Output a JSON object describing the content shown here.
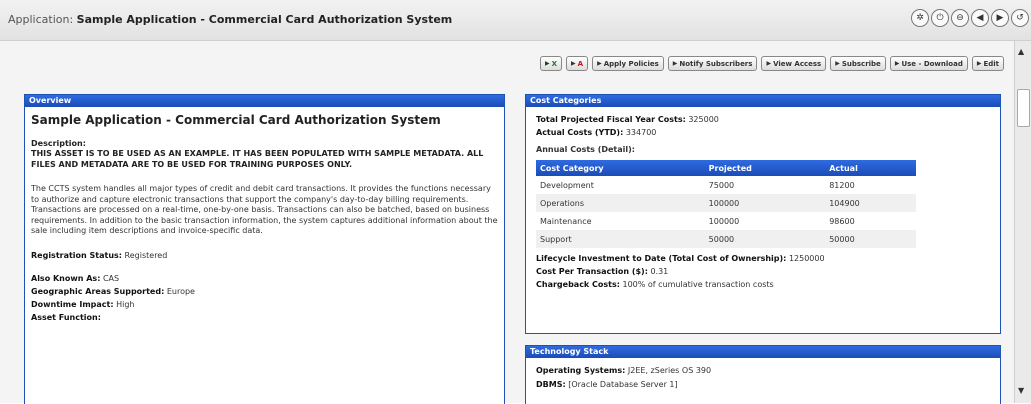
{
  "titlebar": {
    "prefix": "Application: ",
    "name": "Sample Application - Commercial Card Authorization System",
    "nav_icons": [
      "help-icon",
      "info-icon",
      "minus-icon",
      "back-icon",
      "forward-icon",
      "refresh-icon"
    ]
  },
  "toolbar": {
    "buttons": [
      {
        "id": "excel",
        "label": "X",
        "icon": "excel-icon"
      },
      {
        "id": "pdf",
        "label": "A",
        "icon": "pdf-icon"
      },
      {
        "id": "apply",
        "label": "Apply Policies"
      },
      {
        "id": "notify",
        "label": "Notify Subscribers"
      },
      {
        "id": "access",
        "label": "View Access"
      },
      {
        "id": "subscribe",
        "label": "Subscribe"
      },
      {
        "id": "download",
        "label": "Use - Download"
      },
      {
        "id": "edit",
        "label": "Edit"
      }
    ]
  },
  "overview": {
    "header": "Overview",
    "title": "Sample Application - Commercial Card Authorization System",
    "description_label": "Description:",
    "description_bold": "THIS ASSET IS TO BE USED AS AN EXAMPLE. IT HAS BEEN POPULATED WITH SAMPLE METADATA. ALL FILES AND METADATA ARE TO BE USED FOR TRAINING PURPOSES ONLY.",
    "description_text": "The CCTS system handles all major types of credit and debit card transactions. It provides the functions necessary to authorize and capture electronic transactions that support the company's day-to-day billing requirements. Transactions are processed on a real-time, one-by-one basis. Transactions can also be batched, based on business requirements. In addition to the basic transaction information, the system captures additional information about the sale including item descriptions and invoice-specific data.",
    "registration_label": "Registration Status:",
    "registration_value": "Registered",
    "aka_label": "Also Known As:",
    "aka_value": "CAS",
    "geo_label": "Geographic Areas Supported:",
    "geo_value": "Europe",
    "downtime_label": "Downtime Impact:",
    "downtime_value": "High",
    "function_label": "Asset Function:"
  },
  "cost": {
    "header": "Cost Categories",
    "total_label": "Total Projected Fiscal Year Costs:",
    "total_value": "325000",
    "actual_label": "Actual Costs (YTD):",
    "actual_value": "334700",
    "annual_label": "Annual Costs (Detail):",
    "columns": [
      "Cost Category",
      "Projected",
      "Actual"
    ],
    "rows": [
      {
        "category": "Development",
        "projected": "75000",
        "actual": "81200"
      },
      {
        "category": "Operations",
        "projected": "100000",
        "actual": "104900"
      },
      {
        "category": "Maintenance",
        "projected": "100000",
        "actual": "98600"
      },
      {
        "category": "Support",
        "projected": "50000",
        "actual": "50000"
      }
    ],
    "lifecycle_label": "Lifecycle Investment to Date (Total Cost of Ownership):",
    "lifecycle_value": "1250000",
    "per_tx_label": "Cost Per Transaction ($):",
    "per_tx_value": "0.31",
    "chargeback_label": "Chargeback Costs:",
    "chargeback_value": "100% of cumulative transaction costs"
  },
  "tech": {
    "header": "Technology Stack",
    "os_label": "Operating Systems:",
    "os_value": "J2EE, zSeries OS 390",
    "dbms_label": "DBMS:",
    "dbms_value": "[Oracle Database Server 1]"
  },
  "colors": {
    "panel_header": "#1f52b5",
    "background": "#f4f4f4"
  }
}
